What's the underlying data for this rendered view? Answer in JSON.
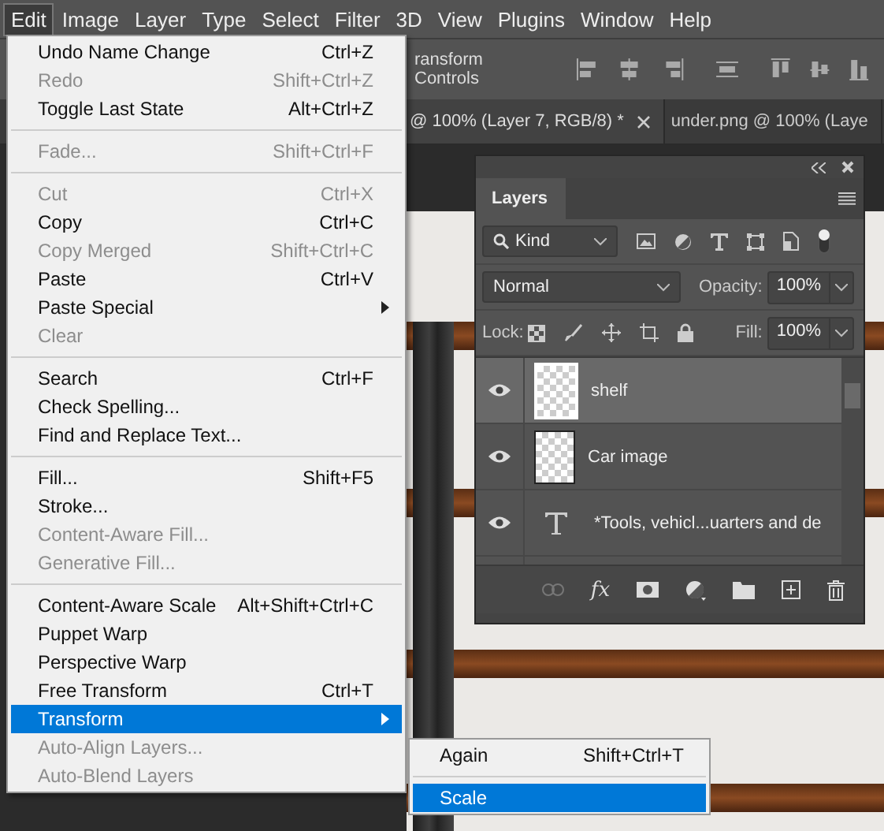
{
  "menubar": [
    {
      "label": "Edit",
      "selected": true
    },
    {
      "label": "Image",
      "selected": false
    },
    {
      "label": "Layer",
      "selected": false
    },
    {
      "label": "Type",
      "selected": false
    },
    {
      "label": "Select",
      "selected": false
    },
    {
      "label": "Filter",
      "selected": false
    },
    {
      "label": "3D",
      "selected": false
    },
    {
      "label": "View",
      "selected": false
    },
    {
      "label": "Plugins",
      "selected": false
    },
    {
      "label": "Window",
      "selected": false
    },
    {
      "label": "Help",
      "selected": false
    }
  ],
  "options_bar": {
    "label": "ransform Controls"
  },
  "doc_tabs": [
    {
      "label": "@ 100% (Layer 7, RGB/8) *",
      "selected": true
    },
    {
      "label": "under.png @ 100% (Laye",
      "selected": false
    }
  ],
  "edit_menu": [
    {
      "kind": "item",
      "label": "Undo Name Change",
      "shortcut": "Ctrl+Z",
      "disabled": false,
      "selected": false
    },
    {
      "kind": "item",
      "label": "Redo",
      "shortcut": "Shift+Ctrl+Z",
      "disabled": true,
      "selected": false
    },
    {
      "kind": "item",
      "label": "Toggle Last State",
      "shortcut": "Alt+Ctrl+Z",
      "disabled": false,
      "selected": false
    },
    {
      "kind": "separator"
    },
    {
      "kind": "item",
      "label": "Fade...",
      "shortcut": "Shift+Ctrl+F",
      "disabled": true,
      "selected": false
    },
    {
      "kind": "separator"
    },
    {
      "kind": "item",
      "label": "Cut",
      "shortcut": "Ctrl+X",
      "disabled": true,
      "selected": false
    },
    {
      "kind": "item",
      "label": "Copy",
      "shortcut": "Ctrl+C",
      "disabled": false,
      "selected": false
    },
    {
      "kind": "item",
      "label": "Copy Merged",
      "shortcut": "Shift+Ctrl+C",
      "disabled": true,
      "selected": false
    },
    {
      "kind": "item",
      "label": "Paste",
      "shortcut": "Ctrl+V",
      "disabled": false,
      "selected": false
    },
    {
      "kind": "item",
      "label": "Paste Special",
      "submenu": true,
      "disabled": false,
      "selected": false
    },
    {
      "kind": "item",
      "label": "Clear",
      "disabled": true,
      "selected": false
    },
    {
      "kind": "separator"
    },
    {
      "kind": "item",
      "label": "Search",
      "shortcut": "Ctrl+F",
      "disabled": false,
      "selected": false
    },
    {
      "kind": "item",
      "label": "Check Spelling...",
      "disabled": false,
      "selected": false
    },
    {
      "kind": "item",
      "label": "Find and Replace Text...",
      "disabled": false,
      "selected": false
    },
    {
      "kind": "separator"
    },
    {
      "kind": "item",
      "label": "Fill...",
      "shortcut": "Shift+F5",
      "disabled": false,
      "selected": false
    },
    {
      "kind": "item",
      "label": "Stroke...",
      "disabled": false,
      "selected": false
    },
    {
      "kind": "item",
      "label": "Content-Aware Fill...",
      "disabled": true,
      "selected": false
    },
    {
      "kind": "item",
      "label": "Generative Fill...",
      "disabled": true,
      "selected": false
    },
    {
      "kind": "separator"
    },
    {
      "kind": "item",
      "label": "Content-Aware Scale",
      "shortcut": "Alt+Shift+Ctrl+C",
      "disabled": false,
      "selected": false
    },
    {
      "kind": "item",
      "label": "Puppet Warp",
      "disabled": false,
      "selected": false
    },
    {
      "kind": "item",
      "label": "Perspective Warp",
      "disabled": false,
      "selected": false
    },
    {
      "kind": "item",
      "label": "Free Transform",
      "shortcut": "Ctrl+T",
      "disabled": false,
      "selected": false
    },
    {
      "kind": "item",
      "label": "Transform",
      "submenu": true,
      "disabled": false,
      "selected": true
    },
    {
      "kind": "item",
      "label": "Auto-Align Layers...",
      "disabled": true,
      "selected": false
    },
    {
      "kind": "item",
      "label": "Auto-Blend Layers",
      "disabled": true,
      "selected": false
    }
  ],
  "transform_submenu": [
    {
      "kind": "item",
      "label": "Again",
      "shortcut": "Shift+Ctrl+T",
      "selected": false
    },
    {
      "kind": "separator"
    },
    {
      "kind": "item",
      "label": "Scale",
      "selected": true
    }
  ],
  "layers_panel": {
    "title": "Layers",
    "filter": "Kind",
    "blend_mode": "Normal",
    "opacity_label": "Opacity:",
    "opacity": "100%",
    "lock_label": "Lock:",
    "fill_label": "Fill:",
    "fill": "100%",
    "layers": [
      {
        "kind": "image",
        "name": "shelf",
        "selected": true
      },
      {
        "kind": "image",
        "name": "Car image",
        "selected": false
      },
      {
        "kind": "text",
        "name": "*Tools, vehicl...uarters and de",
        "selected": false
      }
    ],
    "effects_button": "fx"
  }
}
